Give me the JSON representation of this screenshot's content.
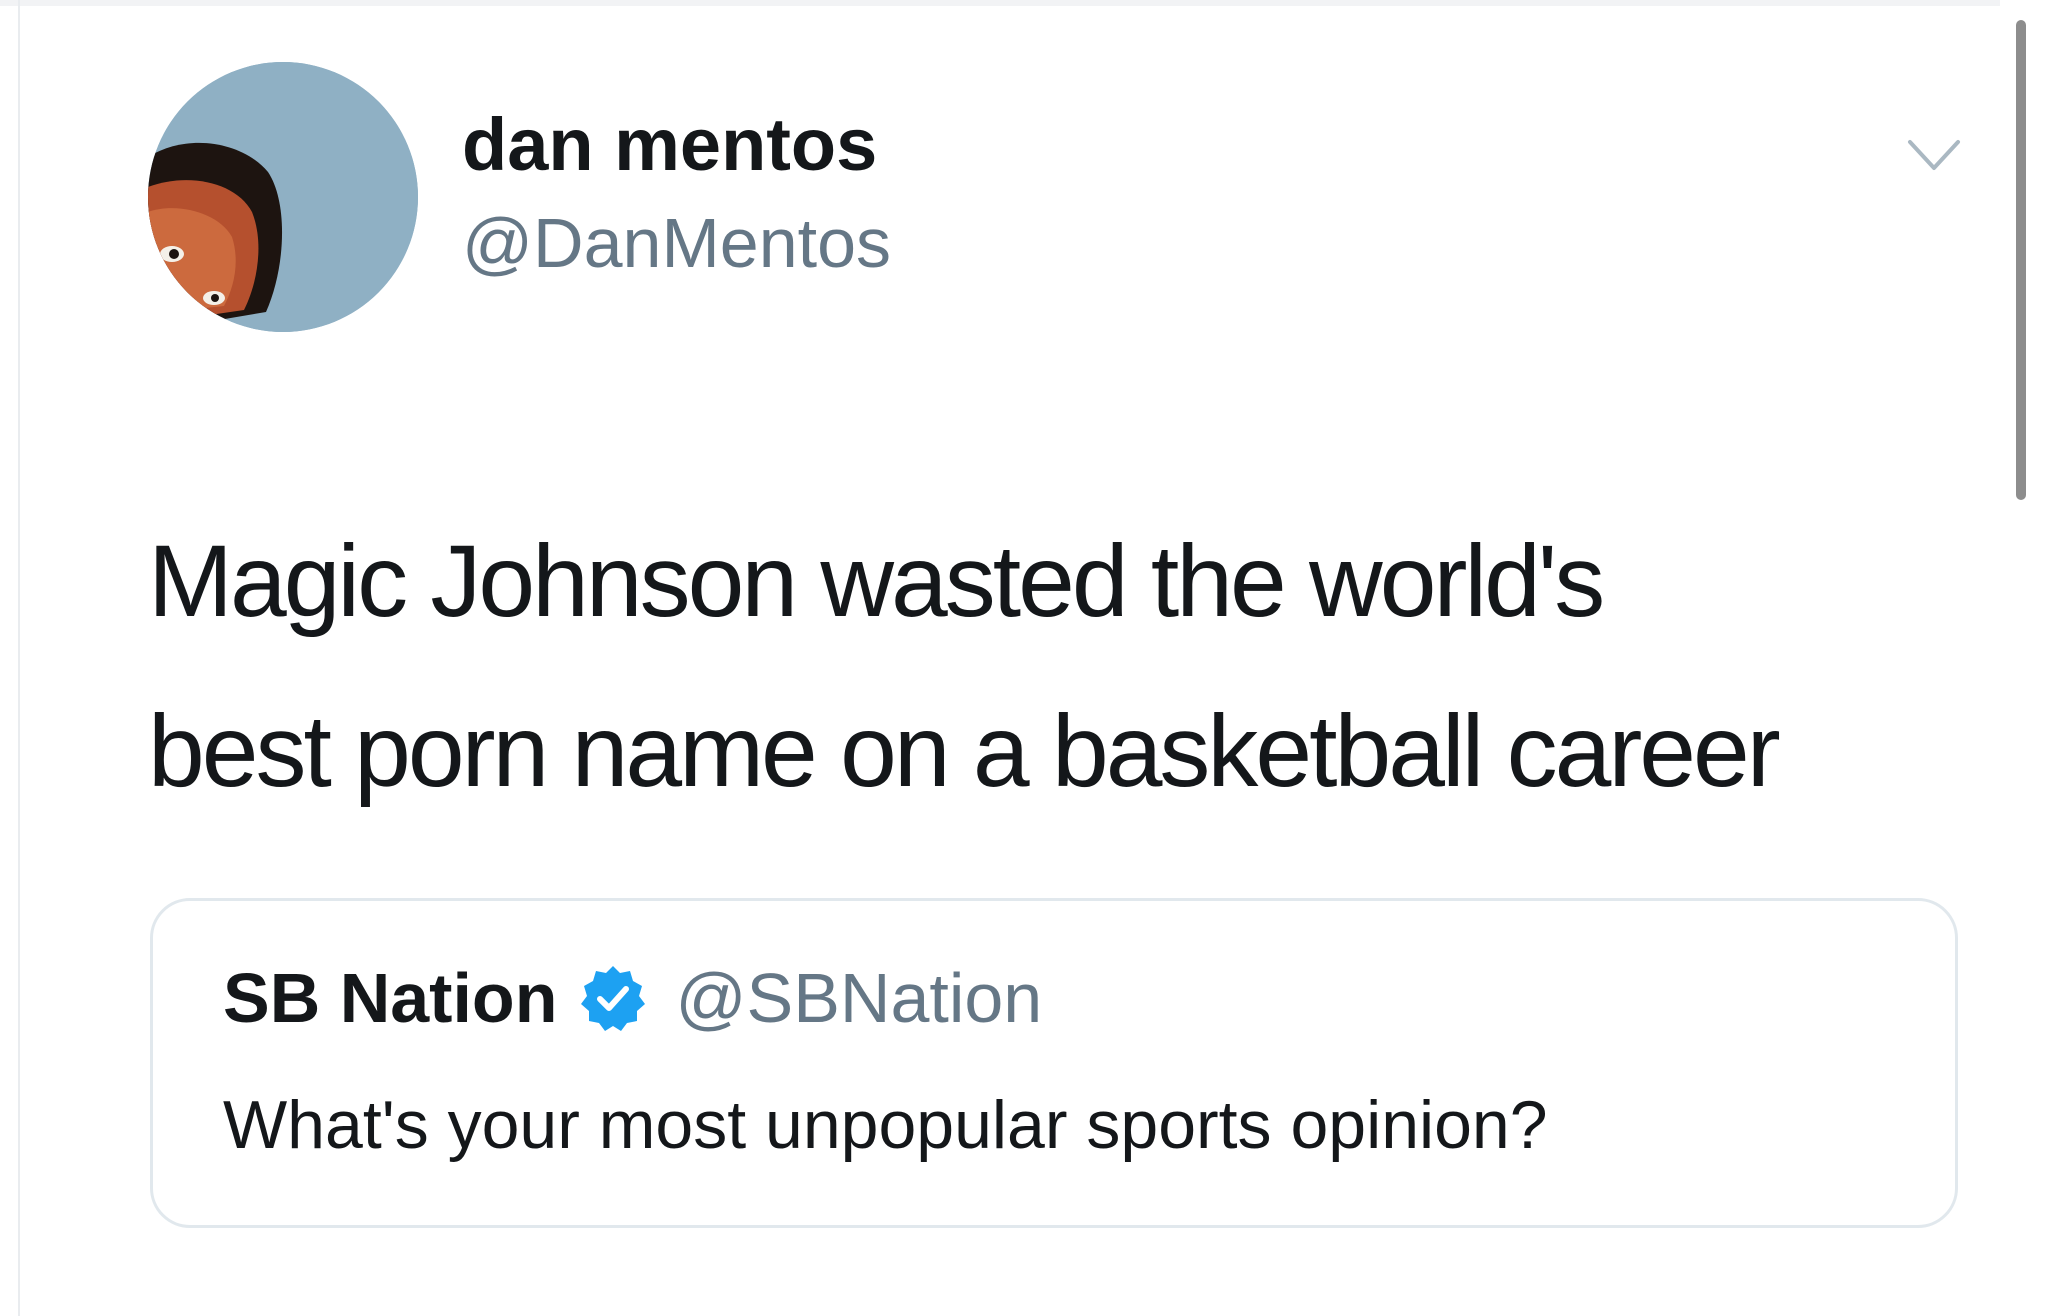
{
  "tweet": {
    "display_name": "dan mentos",
    "handle": "@DanMentos",
    "avatar_icon": "profile-photo",
    "menu_icon": "chevron-down-icon",
    "text_lines": [
      "Magic Johnson wasted the world's",
      "best porn name on a basketball career"
    ]
  },
  "quoted_tweet": {
    "display_name": "SB Nation",
    "verified_icon": "verified-badge-icon",
    "handle": "@SBNation",
    "text": "What's your most unpopular sports opinion?"
  },
  "colors": {
    "text_primary": "#14171a",
    "text_secondary": "#657786",
    "verified_blue": "#1da1f2",
    "card_border": "#e1e8ed",
    "avatar_background": "#8fb0c4"
  }
}
